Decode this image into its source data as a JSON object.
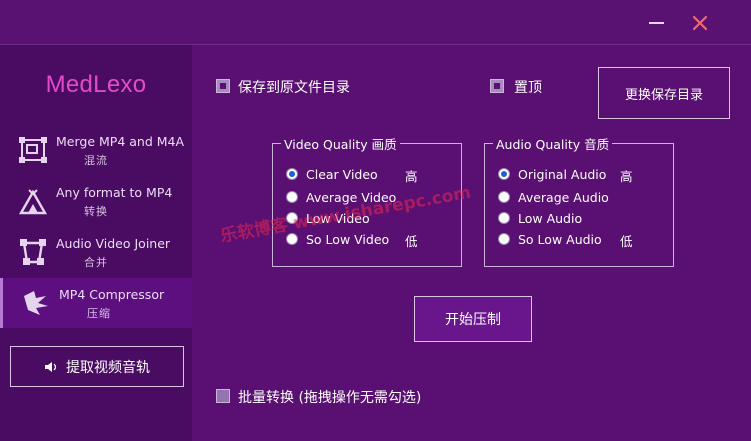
{
  "window": {
    "minimize_icon": "minimize-icon",
    "close_icon": "close-icon",
    "close_color": "#f06a6a"
  },
  "sidebar": {
    "logo": "MedLexo",
    "items": [
      {
        "title": "Merge MP4 and M4A",
        "sub": "混流",
        "icon": "merge-icon"
      },
      {
        "title": "Any format to MP4",
        "sub": "转换",
        "icon": "convert-icon"
      },
      {
        "title": "Audio Video Joiner",
        "sub": "合并",
        "icon": "joiner-icon"
      },
      {
        "title": "MP4 Compressor",
        "sub": "压缩",
        "icon": "compressor-icon",
        "active": true
      }
    ],
    "extract_button": "提取视频音轨"
  },
  "options": {
    "save_to_original": "保存到原文件目录",
    "pin_top": "置顶",
    "change_dir_button": "更换保存目录"
  },
  "video_quality": {
    "legend": "Video Quality 画质",
    "options": [
      "Clear Video",
      "Average Video",
      "Low Video",
      "So Low Video"
    ],
    "selected": 0,
    "high_tag": "高",
    "low_tag": "低"
  },
  "audio_quality": {
    "legend": "Audio Quality 音质",
    "options": [
      "Original Audio",
      "Average Audio",
      "Low Audio",
      "So Low Audio"
    ],
    "selected": 0,
    "high_tag": "高",
    "low_tag": "低"
  },
  "start_button": "开始压制",
  "batch": {
    "label": "批量转换  (拖拽操作无需勾选)"
  },
  "watermark": "乐软博客 www.isharepc.com",
  "colors": {
    "background": "#5a0f73",
    "sidebar": "#4a0c62",
    "accent": "#e34bc9",
    "radio_dot": "#1c5fd6"
  }
}
